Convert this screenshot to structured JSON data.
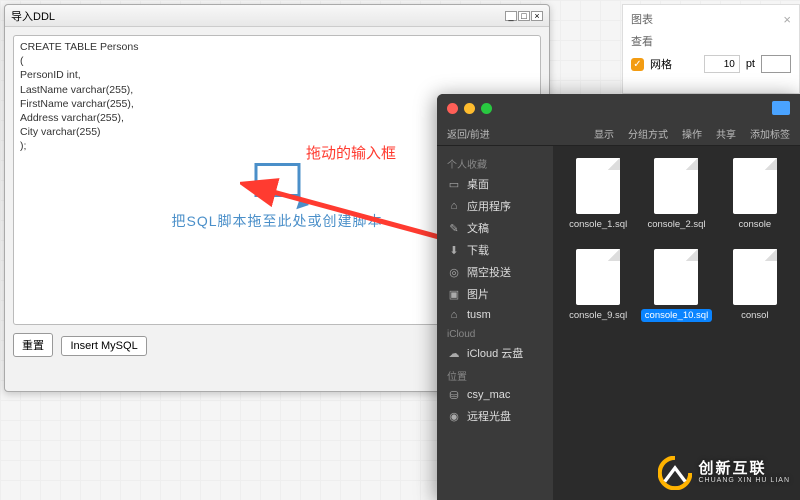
{
  "ddl": {
    "title": "导入DDL",
    "sql": "CREATE TABLE Persons\n(\nPersonID int,\nLastName varchar(255),\nFirstName varchar(255),\nAddress varchar(255),\nCity varchar(255)\n);",
    "dropzone_text": "把SQL脚本拖至此处或创建脚本",
    "reset_btn": "重置",
    "insert_btn": "Insert MySQL"
  },
  "annotation": {
    "label": "拖动的输入框"
  },
  "chart_panel": {
    "title": "图表",
    "section": "查看",
    "grid_label": "网格",
    "size_value": "10",
    "size_unit": "pt"
  },
  "finder": {
    "nav_label": "返回/前进",
    "toolbar": {
      "view": "显示",
      "group": "分组方式",
      "action": "操作",
      "share": "共享",
      "tag": "添加标签"
    },
    "sections": {
      "fav": "个人收藏",
      "icloud": "iCloud",
      "loc": "位置"
    },
    "sidebar": {
      "fav": [
        {
          "icon": "desktop",
          "label": "桌面"
        },
        {
          "icon": "app",
          "label": "应用程序"
        },
        {
          "icon": "doc",
          "label": "文稿"
        },
        {
          "icon": "down",
          "label": "下载"
        },
        {
          "icon": "airdrop",
          "label": "隔空投送"
        },
        {
          "icon": "pic",
          "label": "图片"
        },
        {
          "icon": "home",
          "label": "tusm"
        }
      ],
      "icloud": [
        {
          "icon": "cloud",
          "label": "iCloud 云盘"
        }
      ],
      "loc": [
        {
          "icon": "disk",
          "label": "csy_mac"
        },
        {
          "icon": "remote",
          "label": "远程光盘"
        }
      ]
    },
    "files": [
      {
        "name": "console_1.sql",
        "selected": false
      },
      {
        "name": "console_2.sql",
        "selected": false
      },
      {
        "name": "console",
        "selected": false
      },
      {
        "name": "console_9.sql",
        "selected": false
      },
      {
        "name": "console_10.sql",
        "selected": true
      },
      {
        "name": "consol",
        "selected": false
      }
    ]
  },
  "watermark": {
    "cn": "创新互联",
    "en": "CHUANG XIN HU LIAN"
  }
}
